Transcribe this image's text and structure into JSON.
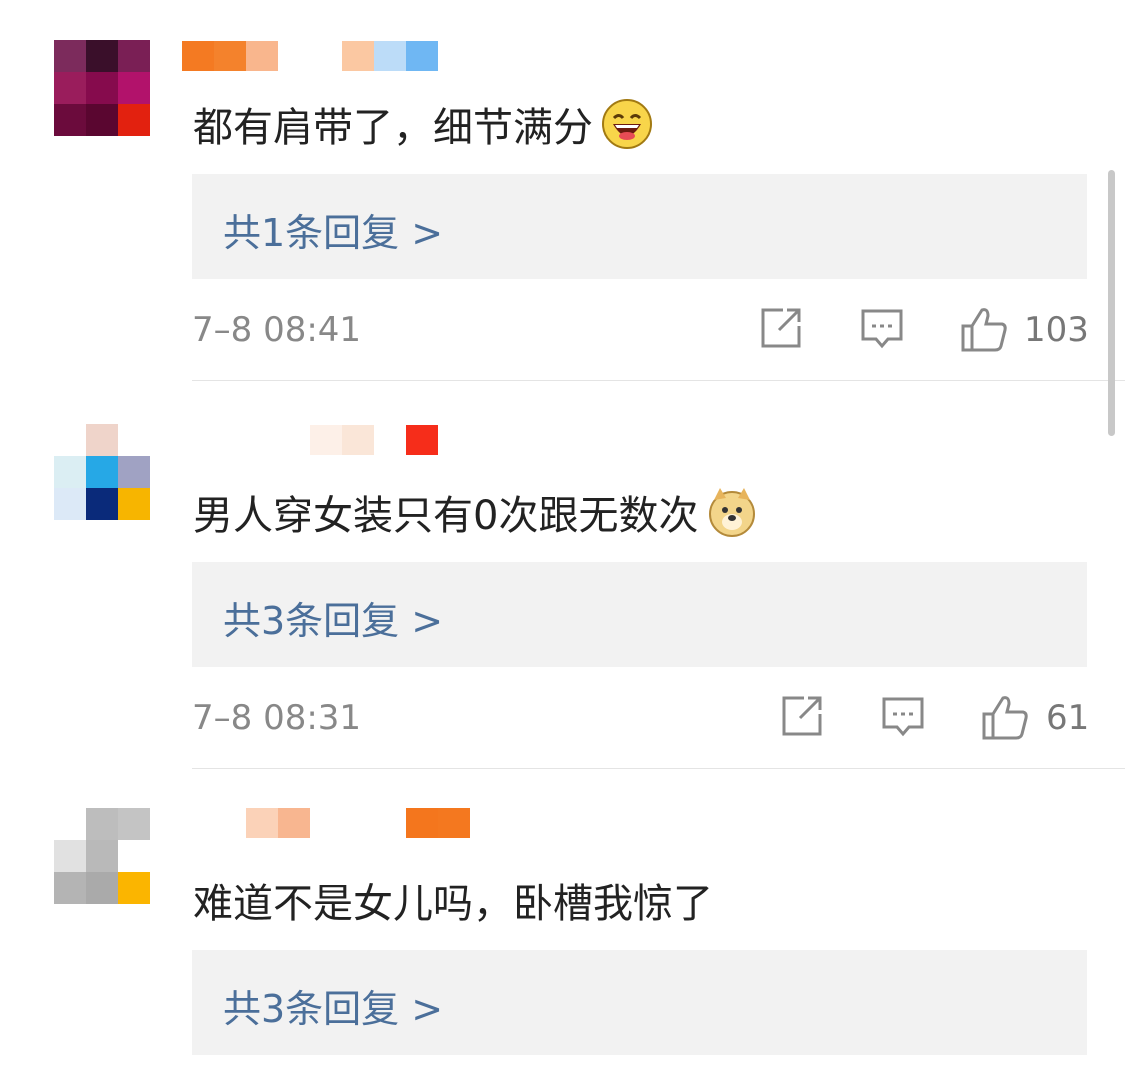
{
  "comments": [
    {
      "text": "都有肩带了，细节满分",
      "emoji": "laughing-emoji",
      "replies_label": "共1条回复 >",
      "time": "7–8 08:41",
      "likes": "103"
    },
    {
      "text": "男人穿女装只有0次跟无数次",
      "emoji": "doge-emoji",
      "replies_label": "共3条回复 >",
      "time": "7–8 08:31",
      "likes": "61"
    },
    {
      "text": "难道不是女儿吗，卧槽我惊了",
      "emoji": "",
      "replies_label": "共3条回复 >"
    }
  ],
  "colors": {
    "reply_link": "#4b6f9a",
    "reply_bg": "#f2f2f2",
    "meta_text": "#888888",
    "body_text": "#222222"
  },
  "icons": [
    "share-icon",
    "comment-icon",
    "like-icon"
  ]
}
